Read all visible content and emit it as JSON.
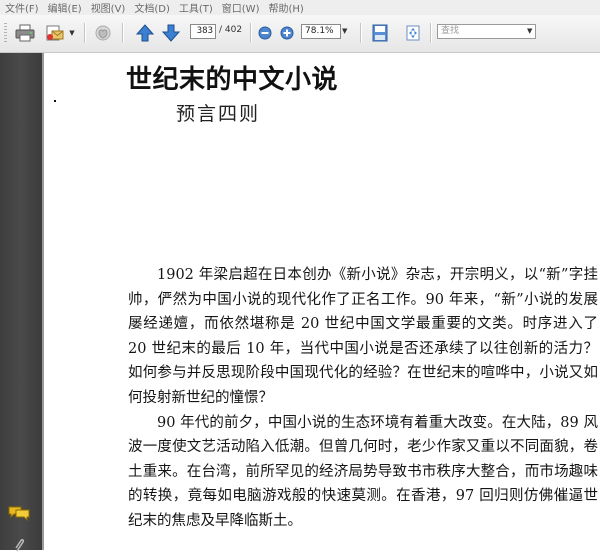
{
  "menu": {
    "items": [
      "文件(F)",
      "编辑(E)",
      "视图(V)",
      "文档(D)",
      "工具(T)",
      "窗口(W)",
      "帮助(H)"
    ]
  },
  "toolbar": {
    "page_current": "383",
    "page_total": "/ 402",
    "zoom": "78.1%",
    "search_placeholder": "查找",
    "icons": [
      "print-icon",
      "email-icon",
      "hand-icon",
      "prev-page-icon",
      "next-page-icon",
      "zoom-out-icon",
      "zoom-in-icon",
      "save-icon",
      "fit-page-icon"
    ]
  },
  "sidebar": {
    "icons": [
      "comment-icon",
      "attachment-icon"
    ]
  },
  "document": {
    "title": "世纪末的中文小说",
    "subtitle": "预言四则",
    "paragraphs": [
      "1902 年梁启超在日本创办《新小说》杂志，开宗明义，以“新”字挂帅，俨然为中国小说的现代化作了正名工作。90 年来，“新”小说的发展屡经递嬗，而依然堪称是 20 世纪中国文学最重要的文类。时序进入了 20 世纪末的最后 10 年，当代中国小说是否还承续了以往创新的活力？如何参与并反思现阶段中国现代化的经验？在世纪末的喧哗中，小说又如何投射新世纪的憧憬？",
      "90 年代的前夕，中国小说的生态环境有着重大改变。在大陆，89 风波一度使文艺活动陷入低潮。但曾几何时，老少作家又重以不同面貌，卷土重来。在台湾，前所罕见的经济局势导致书市秩序大整合，而市场趣味的转换，竟每如电脑游戏般的快速莫测。在香港，97 回归则仿佛催逼世纪末的焦虑及早降临斯土。"
    ]
  },
  "colors": {
    "menubar_bg": "#eeeeee",
    "toolbar_bg": "#ececec",
    "sidebar_bg": "#444444",
    "arrow_blue": "#2f6db8"
  }
}
